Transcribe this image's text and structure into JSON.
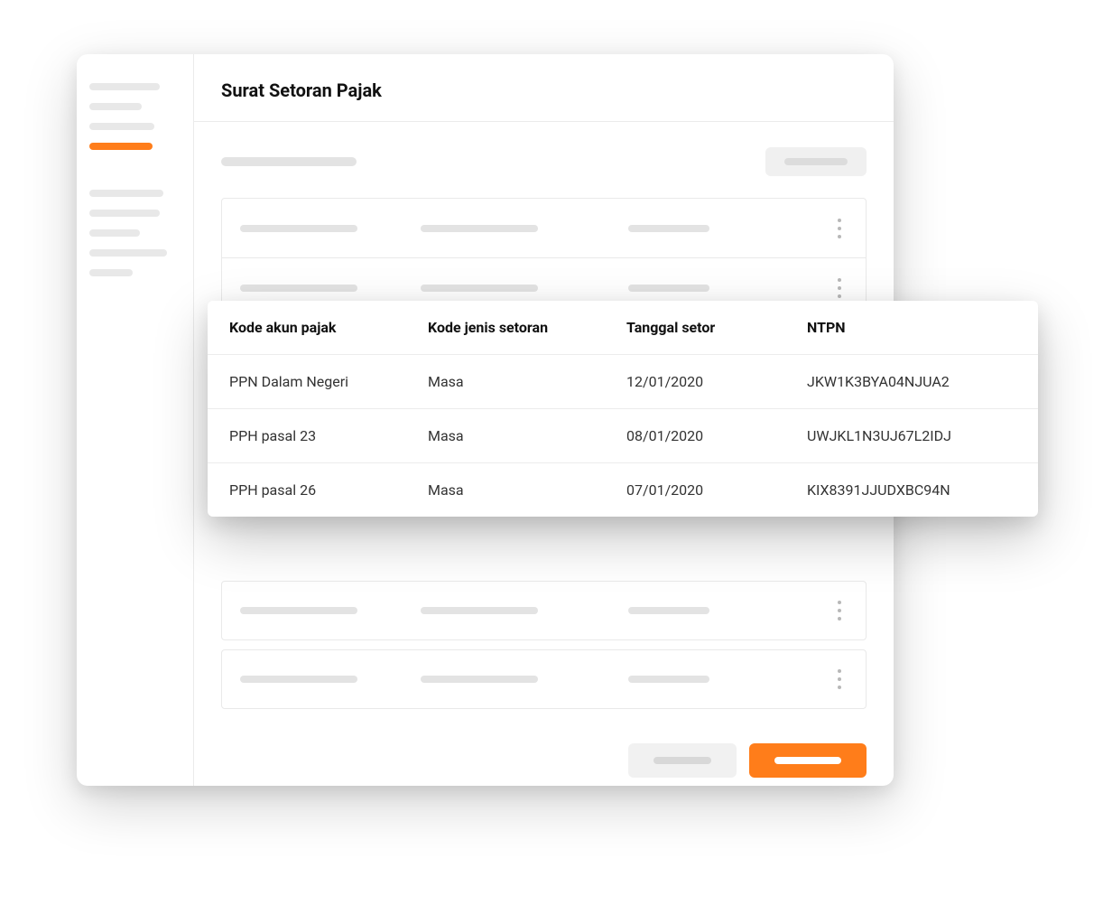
{
  "page": {
    "title": "Surat Setoran Pajak"
  },
  "colors": {
    "accent": "#ff7d1a"
  },
  "overlay": {
    "headers": {
      "kode_akun_pajak": "Kode akun pajak",
      "kode_jenis_setoran": "Kode jenis setoran",
      "tanggal_setor": "Tanggal setor",
      "ntpn": "NTPN"
    },
    "rows": [
      {
        "kode_akun_pajak": "PPN Dalam Negeri",
        "kode_jenis_setoran": "Masa",
        "tanggal_setor": "12/01/2020",
        "ntpn": "JKW1K3BYA04NJUA2"
      },
      {
        "kode_akun_pajak": "PPH pasal 23",
        "kode_jenis_setoran": "Masa",
        "tanggal_setor": "08/01/2020",
        "ntpn": "UWJKL1N3UJ67L2IDJ"
      },
      {
        "kode_akun_pajak": "PPH pasal 26",
        "kode_jenis_setoran": "Masa",
        "tanggal_setor": "07/01/2020",
        "ntpn": "KIX8391JJUDXBC94N"
      }
    ]
  }
}
